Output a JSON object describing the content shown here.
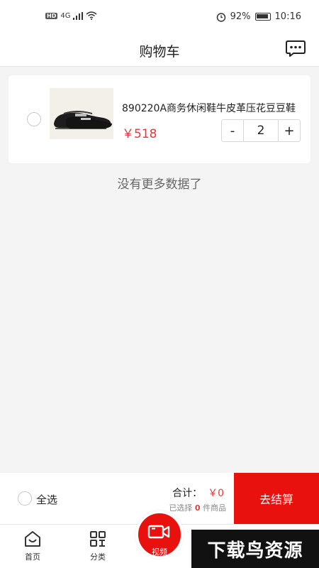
{
  "status_bar": {
    "hd": "HD",
    "network": "4G",
    "battery_percent": "92%",
    "time": "10:16"
  },
  "header": {
    "title": "购物车",
    "message_icon": "chat-bubble-icon"
  },
  "cart": {
    "items": [
      {
        "name": "890220A商务休闲鞋牛皮革压花豆豆鞋",
        "price": "￥518",
        "quantity": "2",
        "selected": false
      }
    ],
    "decrement_label": "-",
    "increment_label": "+",
    "end_text": "没有更多数据了"
  },
  "checkout": {
    "select_all_label": "全选",
    "total_label": "合计：",
    "total_value": "￥0",
    "selected_prefix": "已选择",
    "selected_count": "0",
    "selected_suffix": "件商品",
    "checkout_label": "去结算",
    "accent_color": "#e8110e"
  },
  "tabbar": {
    "tabs": [
      {
        "label": "首页",
        "icon": "home-icon"
      },
      {
        "label": "分类",
        "icon": "category-icon"
      }
    ],
    "video_label": "视频",
    "video_icon": "video-camera-icon"
  },
  "watermark": "下载鸟资源"
}
